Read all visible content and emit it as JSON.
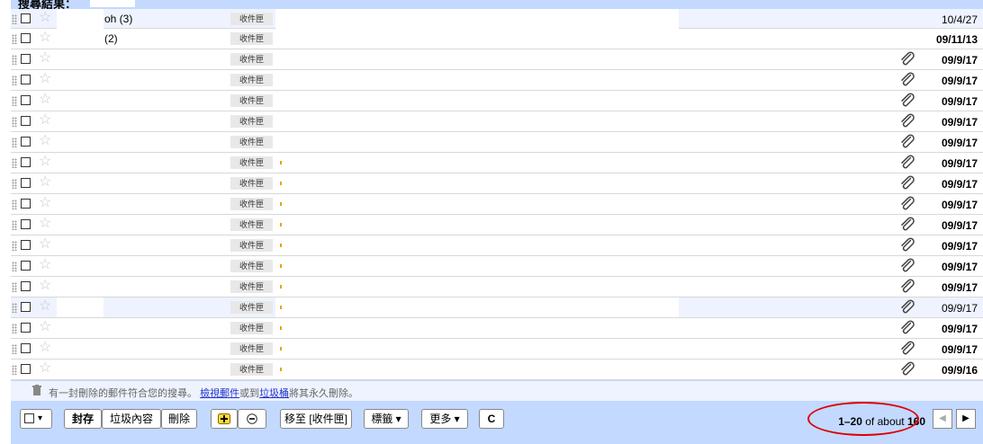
{
  "header": {
    "title": "搜尋結果："
  },
  "rows": [
    {
      "sender": "oh (3)",
      "label": "收件匣",
      "date": "10/4/27",
      "bold": false,
      "attachment": false,
      "alt": false
    },
    {
      "sender": "(2)",
      "label": "收件匣",
      "date": "09/11/13",
      "bold": true,
      "attachment": false,
      "alt": false
    },
    {
      "sender": "",
      "label": "收件匣",
      "date": "09/9/17",
      "bold": true,
      "attachment": true,
      "alt": false
    },
    {
      "sender": "",
      "label": "收件匣",
      "date": "09/9/17",
      "bold": true,
      "attachment": true,
      "alt": false
    },
    {
      "sender": "",
      "label": "收件匣",
      "date": "09/9/17",
      "bold": true,
      "attachment": true,
      "alt": false
    },
    {
      "sender": "",
      "label": "收件匣",
      "date": "09/9/17",
      "bold": true,
      "attachment": true,
      "alt": false
    },
    {
      "sender": "",
      "label": "收件匣",
      "date": "09/9/17",
      "bold": true,
      "attachment": true,
      "alt": false
    },
    {
      "sender": "",
      "label": "收件匣",
      "date": "09/9/17",
      "bold": true,
      "attachment": true,
      "alt": false
    },
    {
      "sender": "",
      "label": "收件匣",
      "date": "09/9/17",
      "bold": true,
      "attachment": true,
      "alt": false
    },
    {
      "sender": "",
      "label": "收件匣",
      "date": "09/9/17",
      "bold": true,
      "attachment": true,
      "alt": false
    },
    {
      "sender": "",
      "label": "收件匣",
      "date": "09/9/17",
      "bold": true,
      "attachment": true,
      "alt": false
    },
    {
      "sender": "",
      "label": "收件匣",
      "date": "09/9/17",
      "bold": true,
      "attachment": true,
      "alt": false
    },
    {
      "sender": "",
      "label": "收件匣",
      "date": "09/9/17",
      "bold": true,
      "attachment": true,
      "alt": false
    },
    {
      "sender": "",
      "label": "收件匣",
      "date": "09/9/17",
      "bold": true,
      "attachment": true,
      "alt": false
    },
    {
      "sender": "",
      "label": "收件匣",
      "date": "09/9/17",
      "bold": false,
      "attachment": true,
      "alt": true
    },
    {
      "sender": "",
      "label": "收件匣",
      "date": "09/9/17",
      "bold": true,
      "attachment": true,
      "alt": false
    },
    {
      "sender": "",
      "label": "收件匣",
      "date": "09/9/17",
      "bold": true,
      "attachment": true,
      "alt": false
    },
    {
      "sender": "",
      "label": "收件匣",
      "date": "09/9/16",
      "bold": true,
      "attachment": true,
      "alt": false
    }
  ],
  "notice": {
    "text1": "有一封刪除的郵件符合您的搜尋。",
    "link1": "檢視郵件",
    "text2": "或到",
    "link2": "垃圾桶",
    "text3": "將其永久刪除。"
  },
  "toolbar": {
    "select_arrow": "▾",
    "archive": "封存",
    "spam": "垃圾內容",
    "delete": "刪除",
    "mark_read_icon": "plus-square-icon",
    "mark_unread_icon": "minus-circle-icon",
    "move_to": "移至 [收件匣]",
    "labels": "標籤 ▾",
    "more": "更多 ▾",
    "refresh": "C"
  },
  "pager": {
    "range": "1–20",
    "of_about": "of about",
    "total": "160",
    "prev": "◀",
    "next": "▶"
  },
  "colors": {
    "panel": "#c3d9ff",
    "highlight_oval": "#dd0000",
    "link": "#2233cc"
  }
}
